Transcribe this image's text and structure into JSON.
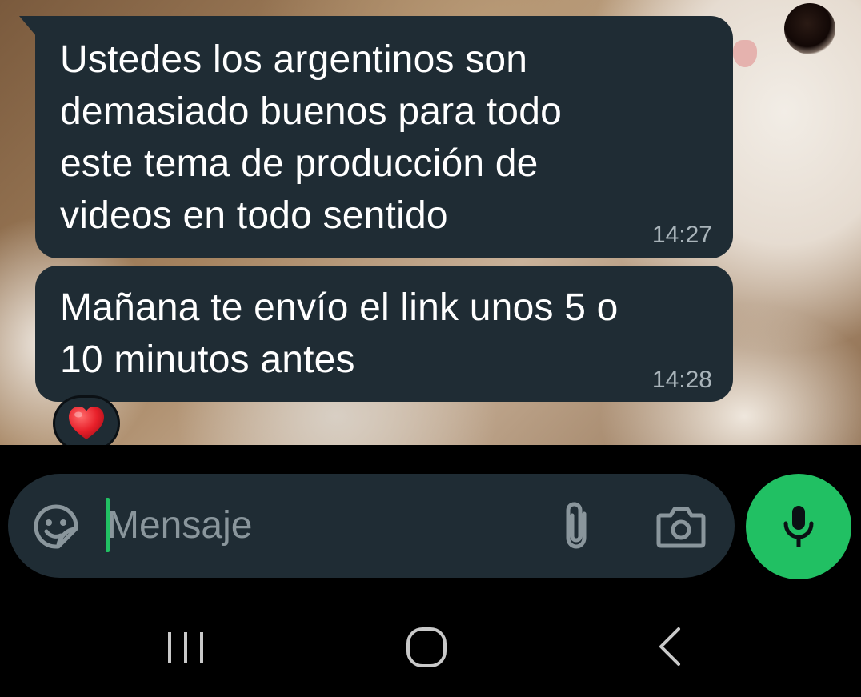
{
  "chat": {
    "messages": [
      {
        "text": "Ustedes los argentinos son\ndemasiado buenos para todo\neste tema de producción de\nvideos en todo sentido",
        "time": "14:27"
      },
      {
        "text": "Mañana te envío el link unos 5 o\n10 minutos antes",
        "time": "14:28",
        "reaction": "❤️"
      }
    ]
  },
  "composer": {
    "placeholder": "Mensaje",
    "value": "",
    "icons": [
      "sticker-icon",
      "attach-icon",
      "camera-icon",
      "mic-icon"
    ],
    "accent_color": "#21c063",
    "bubble_color": "#1f2c34"
  },
  "nav_bar": {
    "icons": [
      "recents-icon",
      "home-icon",
      "back-icon"
    ]
  }
}
